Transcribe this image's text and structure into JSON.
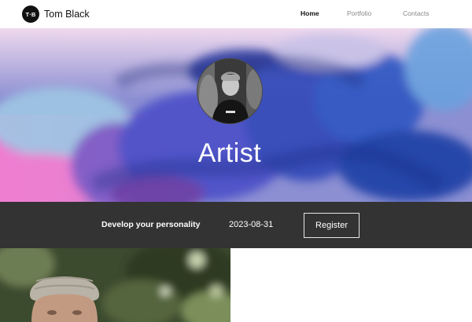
{
  "header": {
    "logo_text": "T·B",
    "brand_name": "Tom Black",
    "nav": [
      {
        "label": "Home",
        "active": true
      },
      {
        "label": "Portfolio",
        "active": false
      },
      {
        "label": "Contacts",
        "active": false
      }
    ]
  },
  "hero": {
    "title": "Artist"
  },
  "event": {
    "title": "Develop your personality",
    "date": "2023-08-31",
    "register_label": "Register"
  },
  "colors": {
    "header_bg": "#ffffff",
    "event_bar_bg": "#333333",
    "hero_blue": "#3f69c8",
    "hero_pink": "#d88fc7"
  }
}
